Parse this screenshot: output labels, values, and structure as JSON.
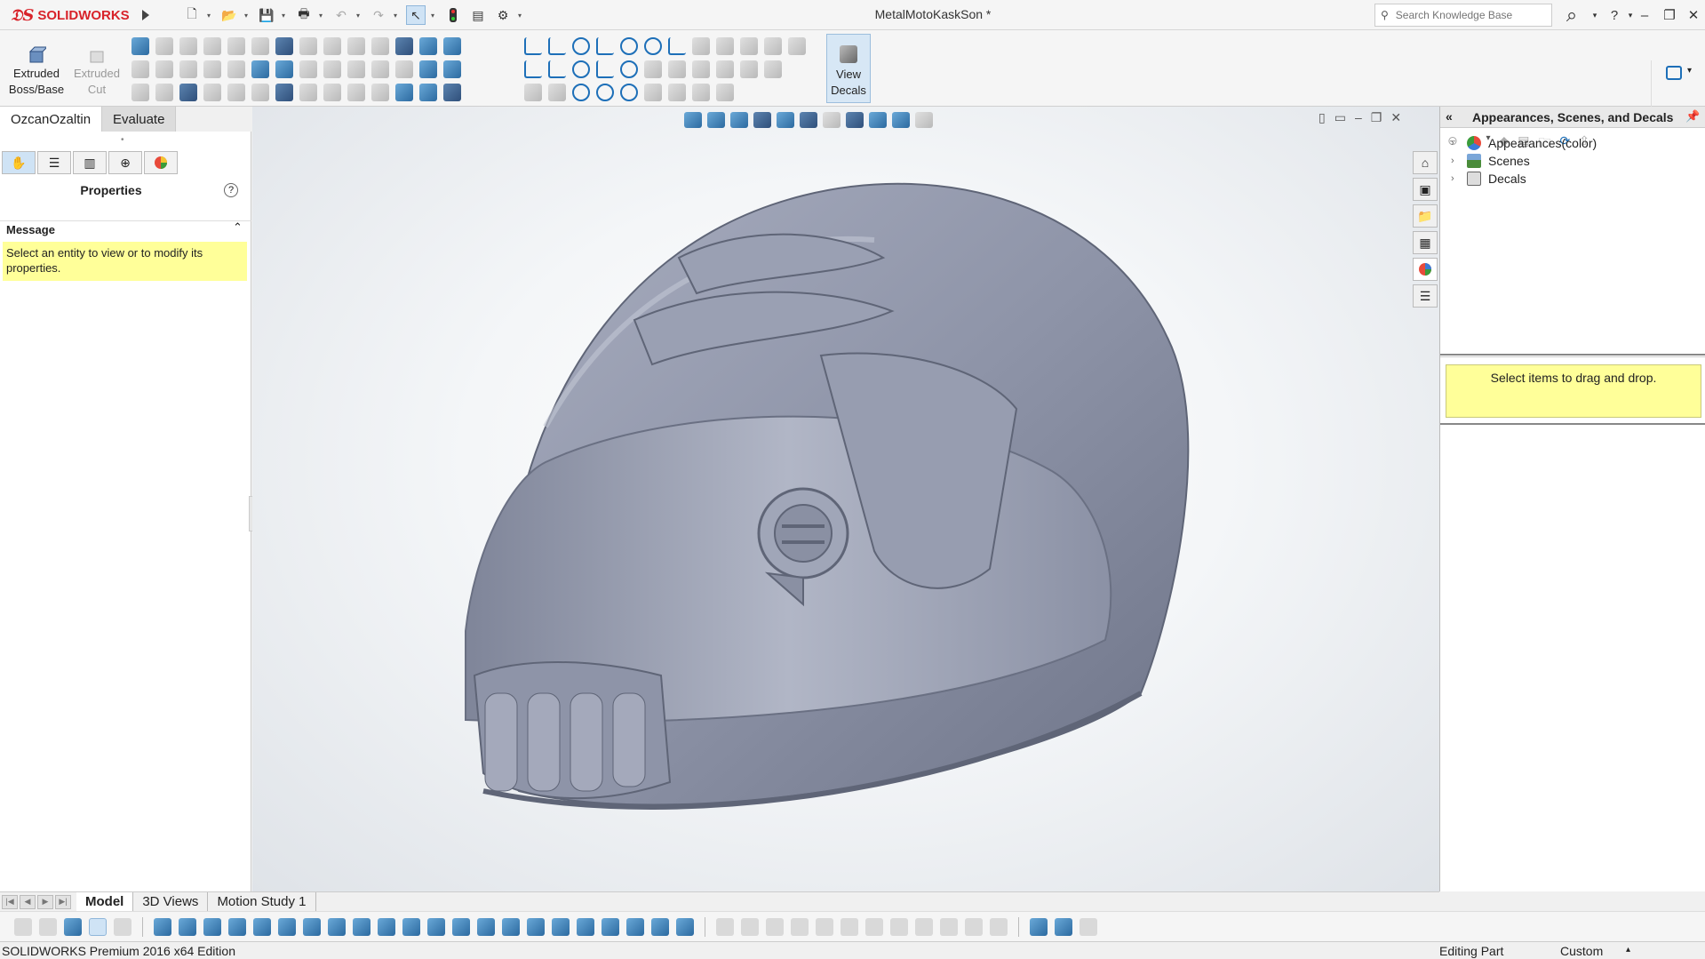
{
  "app": {
    "brand": "SOLIDWORKS",
    "document_title": "MetalMotoKaskSon *"
  },
  "search": {
    "placeholder": "Search Knowledge Base"
  },
  "window_buttons": {
    "help": "?",
    "minimize": "–",
    "restore": "❐",
    "close": "✕"
  },
  "command_manager": {
    "extruded_boss": "Extruded Boss/Base",
    "extruded_cut": "Extruded Cut",
    "view_decals": "View Decals"
  },
  "tabs": [
    {
      "label": "OzcanOzaltin",
      "active": true
    },
    {
      "label": "Evaluate",
      "active": false
    }
  ],
  "property_manager": {
    "title": "Properties",
    "help_glyph": "?",
    "message_header": "Message",
    "message_text": "Select an entity to view or to modify its properties."
  },
  "task_pane": {
    "title": "Appearances, Scenes, and Decals",
    "tree": [
      {
        "label": "Appearances(color)",
        "icon": "color-ball-icon",
        "color": "#e84a3a"
      },
      {
        "label": "Scenes",
        "icon": "scene-icon",
        "color": "#4a8c3a"
      },
      {
        "label": "Decals",
        "icon": "decal-icon",
        "color": "#888888"
      }
    ],
    "drop_hint": "Select items to drag and drop."
  },
  "bottom_tabs": [
    {
      "label": "Model",
      "active": true
    },
    {
      "label": "3D Views",
      "active": false
    },
    {
      "label": "Motion Study 1",
      "active": false
    }
  ],
  "status": {
    "product": "SOLIDWORKS Premium 2016 x64 Edition",
    "mode": "Editing Part",
    "units": "Custom"
  },
  "model": {
    "name": "motorcycle-helmet",
    "color": "#8e94a8"
  }
}
